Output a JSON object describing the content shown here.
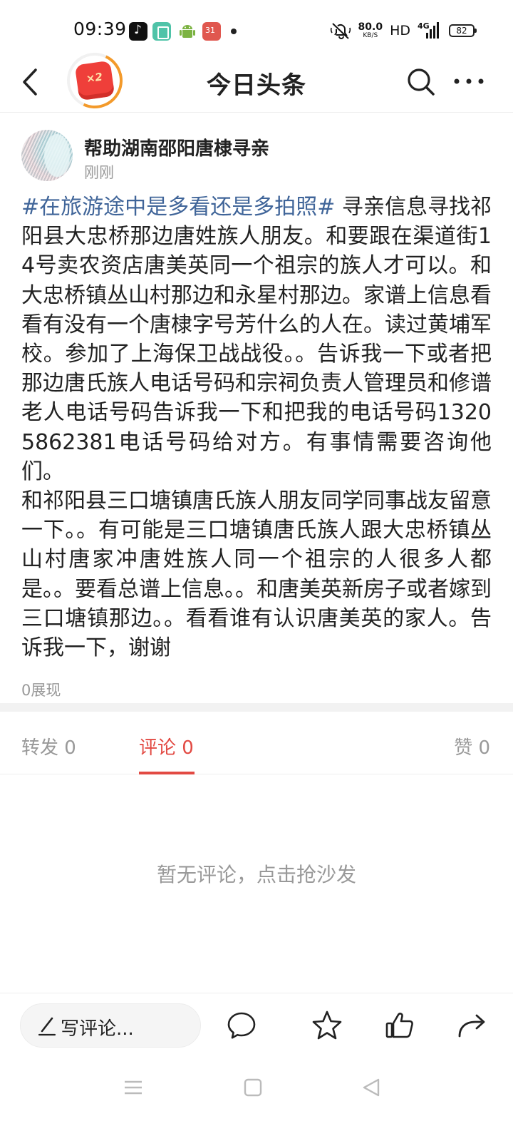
{
  "status_bar": {
    "time": "09:39",
    "net_speed_value": "80.0",
    "net_speed_unit": "KB/S",
    "hd": "HD",
    "network": "4G",
    "battery": "82",
    "icons": [
      "tiktok-icon",
      "book-app-icon",
      "android-icon",
      "calendar-icon",
      "mute-icon",
      "signal-icon",
      "battery-icon"
    ],
    "calendar_day": "31"
  },
  "nav": {
    "title": "今日头条",
    "reward_badge": "×2"
  },
  "post": {
    "author": "帮助湖南邵阳唐棣寻亲",
    "time": "刚刚",
    "hashtag": "#在旅游途中是多看还是多拍照#",
    "body_part1": " 寻亲信息寻找祁阳县大忠桥那边唐姓族人朋友。和要跟在渠道街14号卖农资店唐美英同一个祖宗的族人才可以。和大忠桥镇丛山村那边和永星村那边。家谱上信息看看有没有一个唐棣字号芳什么的人在。读过黄埔军校。参加了上海保卫战战役。。告诉我一下或者把那边唐氏族人电话号码和宗祠负责人管理员和修谱老人电话号码告诉我一下和把我的电话号码13205862381电话号码给对方。有事情需要咨询他们。",
    "body_part2": "和祁阳县三口塘镇唐氏族人朋友同学同事战友留意一下。。有可能是三口塘镇唐氏族人跟大忠桥镇丛山村唐家冲唐姓族人同一个祖宗的人很多人都是。。要看总谱上信息。。和唐美英新房子或者嫁到三口塘镇那边。。看看谁有认识唐美英的家人。告诉我一下，谢谢",
    "impressions": "0展现"
  },
  "tabs": {
    "repost": "转发 0",
    "comment": "评论 0",
    "like": "赞 0"
  },
  "comments": {
    "empty_text": "暂无评论，点击抢沙发"
  },
  "action_bar": {
    "write_comment": "写评论..."
  },
  "colors": {
    "accent": "#e24a43",
    "hashtag": "#406599",
    "muted": "#999999",
    "reward_ring": "#f39a2b"
  }
}
